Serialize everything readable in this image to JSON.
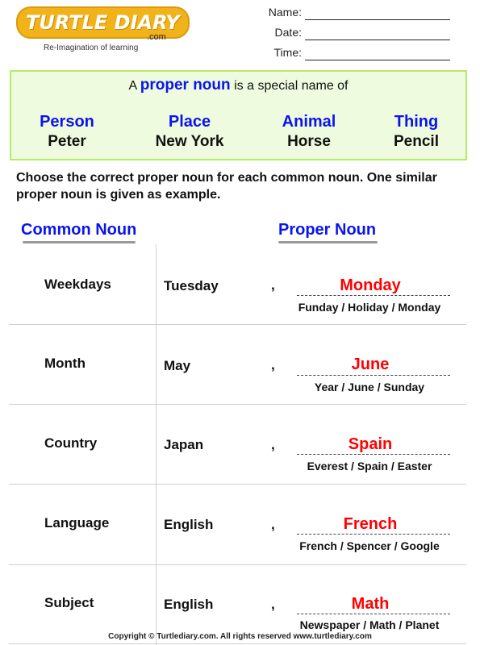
{
  "header": {
    "logo_text": "TURTLE DIARY",
    "logo_suffix": ".com",
    "tagline": "Re-Imagination of learning",
    "fields": [
      {
        "label": "Name:"
      },
      {
        "label": "Date:"
      },
      {
        "label": "Time:"
      }
    ]
  },
  "definition": {
    "prefix": "A",
    "highlight": "proper noun",
    "suffix": "is a special name of",
    "categories": [
      {
        "category": "Person",
        "example": "Peter"
      },
      {
        "category": "Place",
        "example": "New York"
      },
      {
        "category": "Animal",
        "example": "Horse"
      },
      {
        "category": "Thing",
        "example": "Pencil"
      }
    ]
  },
  "instruction": "Choose the correct proper noun for each common noun. One similar proper noun is given as example.",
  "table": {
    "headers": {
      "common": "Common Noun",
      "proper": "Proper Noun"
    },
    "rows": [
      {
        "common": "Weekdays",
        "example": "Tuesday",
        "comma": ",",
        "answer": "Monday",
        "options": "Funday / Holiday / Monday"
      },
      {
        "common": "Month",
        "example": "May",
        "comma": ",",
        "answer": "June",
        "options": "Year / June / Sunday"
      },
      {
        "common": "Country",
        "example": "Japan",
        "comma": ",",
        "answer": "Spain",
        "options": "Everest / Spain / Easter"
      },
      {
        "common": "Language",
        "example": "English",
        "comma": ",",
        "answer": "French",
        "options": "French / Spencer / Google"
      },
      {
        "common": "Subject",
        "example": "English",
        "comma": ",",
        "answer": "Math",
        "options": "Newspaper / Math / Planet"
      }
    ]
  },
  "footer": {
    "copyright": "Copyright © Turtlediary.com. All rights reserved  www.turtlediary.com"
  },
  "colors": {
    "accent_blue": "#0a14ee",
    "answer_red": "#ff0000",
    "box_fill": "#effbdf",
    "box_border": "#b4ec6a",
    "logo_orange": "#f2b31a"
  }
}
